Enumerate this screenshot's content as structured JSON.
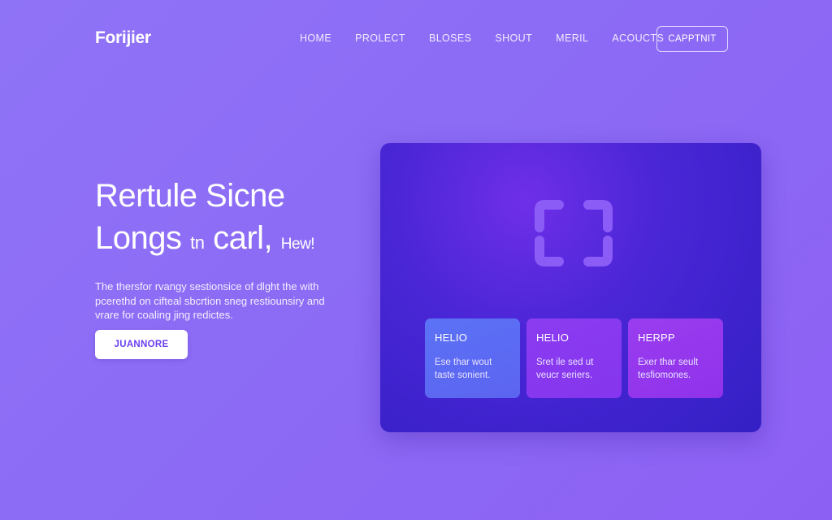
{
  "header": {
    "logo": "Forijier",
    "nav": [
      {
        "label": "HOME"
      },
      {
        "label": "PROLECT"
      },
      {
        "label": "BLOSES"
      },
      {
        "label": "SHOUT"
      },
      {
        "label": "MERIL"
      },
      {
        "label": "ACOUCTS"
      }
    ],
    "cta_label": "CAPPTNIT"
  },
  "hero": {
    "title_line1": "Rertule Sicne",
    "title_line2_a": "Longs",
    "title_line2_b": "tn",
    "title_line2_c": "carl,",
    "title_line2_d": "Hew!",
    "description": "The thersfor rvangy sestionsice of dlght the with pcerethd on cifteal sbcrtion sneg restiounsiry and vrare for coaling jing redictes.",
    "button_label": "JUANNORE"
  },
  "panel": {
    "icon": "frame-corners-icon",
    "cards": [
      {
        "title": "HELIO",
        "text": "Ese thar wout taste sonient."
      },
      {
        "title": "HELIO",
        "text": "Sret ile sed ut veucr seriers."
      },
      {
        "title": "HERPP",
        "text": "Exer thar seult tesfiomones."
      }
    ]
  },
  "colors": {
    "background": "#8c6bf5",
    "panel": "#3a22c8",
    "card_blue": "#5b6cf4",
    "card_purple": "#8a38ef",
    "button_text": "#6a3ef0"
  }
}
